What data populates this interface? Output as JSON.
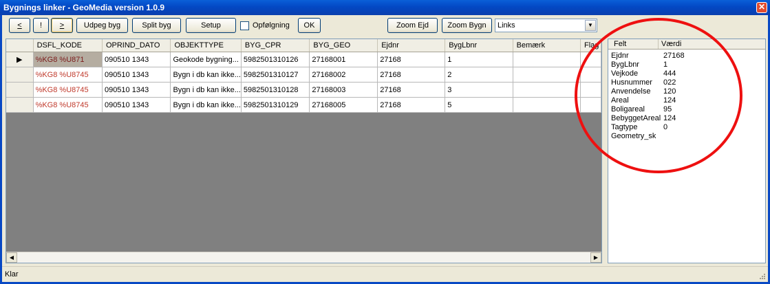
{
  "window": {
    "title": "Bygnings linker - GeoMedia version 1.0.9",
    "close_glyph": "✕"
  },
  "toolbar": {
    "prev_label": "<",
    "bang_label": "!",
    "next_label": ">",
    "udpeg_label": "Udpeg byg",
    "split_label": "Split byg",
    "setup_label": "Setup",
    "opfoelgning_label": "Opfølgning",
    "ok_label": "OK",
    "zoom_ejd_label": "Zoom Ejd",
    "zoom_bygn_label": "Zoom Bygn",
    "links_value": "Links"
  },
  "grid": {
    "columns": [
      "DSFL_KODE",
      "OPRIND_DATO",
      "OBJEKTTYPE",
      "BYG_CPR",
      "BYG_GEO",
      "Ejdnr",
      "BygLbnr",
      "Bemærk",
      "Flag"
    ],
    "rows": [
      {
        "indicator": "▶",
        "cells": [
          "%KG8 %U871",
          "090510 1343",
          "Geokode bygning...",
          "5982501310126",
          "27168001",
          "27168",
          "1",
          "",
          ""
        ]
      },
      {
        "indicator": "",
        "cells": [
          "%KG8 %U8745",
          "090510 1343",
          "Bygn i db kan ikke...",
          "5982501310127",
          "27168002",
          "27168",
          "2",
          "",
          ""
        ]
      },
      {
        "indicator": "",
        "cells": [
          "%KG8 %U8745",
          "090510 1343",
          "Bygn i db kan ikke...",
          "5982501310128",
          "27168003",
          "27168",
          "3",
          "",
          ""
        ]
      },
      {
        "indicator": "",
        "cells": [
          "%KG8 %U8745",
          "090510 1343",
          "Bygn i db kan ikke...",
          "5982501310129",
          "27168005",
          "27168",
          "5",
          "",
          ""
        ]
      }
    ]
  },
  "details": {
    "header_field": "Felt",
    "header_value": "Værdi",
    "rows": [
      {
        "field": "Ejdnr",
        "value": "27168"
      },
      {
        "field": "BygLbnr",
        "value": "1"
      },
      {
        "field": "Vejkode",
        "value": "444"
      },
      {
        "field": "Husnummer",
        "value": "022"
      },
      {
        "field": "Anvendelse",
        "value": "120"
      },
      {
        "field": "Areal",
        "value": "124"
      },
      {
        "field": "Boligareal",
        "value": "95"
      },
      {
        "field": "BebyggetAreal",
        "value": "124"
      },
      {
        "field": "Tagtype",
        "value": "0"
      },
      {
        "field": "Geometry_sk",
        "value": ""
      }
    ]
  },
  "status": {
    "text": "Klar"
  },
  "colors": {
    "titlebar": "#0348c4",
    "annotation_circle": "#ee1010",
    "dsfl_text": "#c0392b"
  }
}
